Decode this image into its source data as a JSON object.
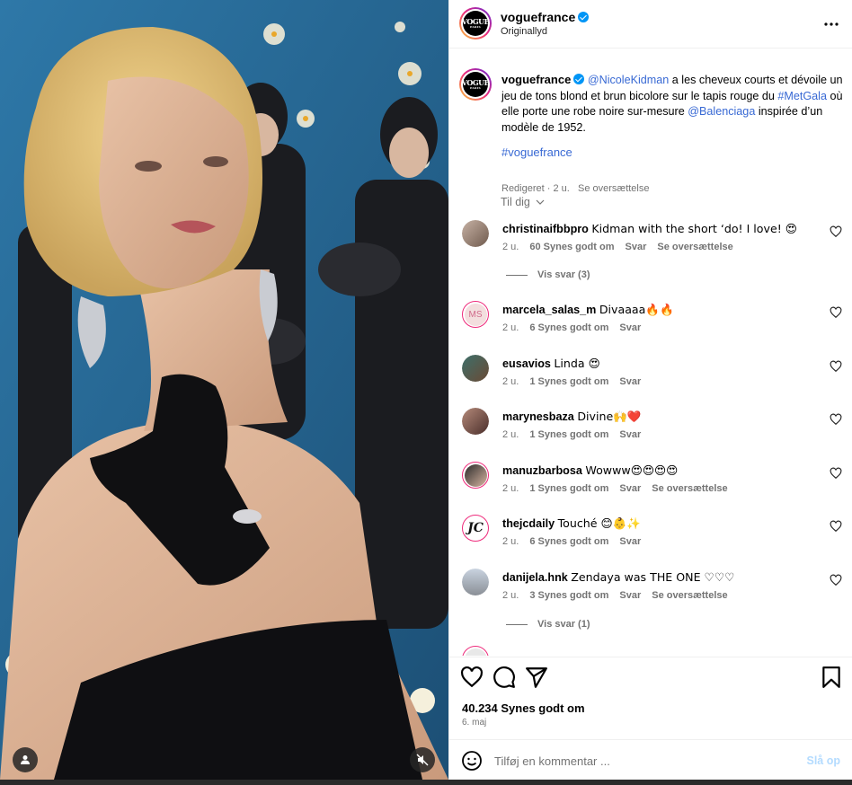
{
  "post": {
    "account": "voguefrance",
    "audio": "Originallyd",
    "logo_text": "VOGUE",
    "logo_sub": "PARIS",
    "caption": {
      "username": "voguefrance",
      "mention1": "@NicoleKidman",
      "text1": " a les cheveux courts et dévoile un jeu de tons blond et brun bicolore sur le tapis rouge du ",
      "hashtag_metgala": "#MetGala",
      "text2": " où elle porte une robe noire sur-mesure ",
      "mention2": "@Balenciaga",
      "text3": " inspirée d’un modèle de 1952.",
      "hashtag": "#voguefrance",
      "meta_edited": "Redigeret · 2 u.",
      "meta_translate": "Se oversættelse"
    },
    "sort_label": "Til dig",
    "comments": [
      {
        "username": "christinaifbbpro",
        "text": "Kidman with the short ‘do! I love! 😍",
        "time": "2 u.",
        "likes": "60 Synes godt om",
        "reply": "Svar",
        "translate": "Se oversættelse",
        "view_replies": "Vis svar (3)",
        "avatar_color": "#8a6a5a"
      },
      {
        "username": "marcela_salas_m",
        "text": "Divaaaa🔥🔥",
        "time": "2 u.",
        "likes": "6 Synes godt om",
        "reply": "Svar",
        "avatar_initials": "MS",
        "avatar_color": "#f3dede"
      },
      {
        "username": "eusavios",
        "text": "Linda 😍",
        "time": "2 u.",
        "likes": "1 Synes godt om",
        "reply": "Svar",
        "avatar_color": "#5a4a3a"
      },
      {
        "username": "marynesbaza",
        "text": "Divine🙌❤️",
        "time": "2 u.",
        "likes": "1 Synes godt om",
        "reply": "Svar",
        "avatar_color": "#6d4b4b"
      },
      {
        "username": "manuzbarbosa",
        "text": "Wowww😍😍😍😍",
        "time": "2 u.",
        "likes": "1 Synes godt om",
        "reply": "Svar",
        "translate": "Se oversættelse",
        "avatar_color": "#3a3a3a"
      },
      {
        "username": "thejcdaily",
        "text": "Touché 😊👶✨",
        "time": "2 u.",
        "likes": "6 Synes godt om",
        "reply": "Svar",
        "avatar_color": "#111111"
      },
      {
        "username": "danijela.hnk",
        "text": "Zendaya was THE ONE ♡♡♡",
        "time": "2 u.",
        "likes": "3 Synes godt om",
        "reply": "Svar",
        "translate": "Se oversættelse",
        "view_replies": "Vis svar (1)",
        "avatar_color": "#8a95a5"
      }
    ],
    "total_likes": "40.234 Synes godt om",
    "date": "6. maj",
    "comment_placeholder": "Tilføj en kommentar ...",
    "post_label": "Slå op"
  },
  "colors": {
    "accent": "#0095f6",
    "hashtag": "#3869d4",
    "muted": "#737373",
    "post_disabled": "#b3dbff"
  },
  "icons": [
    "heart-icon",
    "comment-icon",
    "share-icon",
    "bookmark-icon",
    "emoji-icon",
    "more-icon",
    "user-tag-icon",
    "mute-icon",
    "verified-icon"
  ]
}
